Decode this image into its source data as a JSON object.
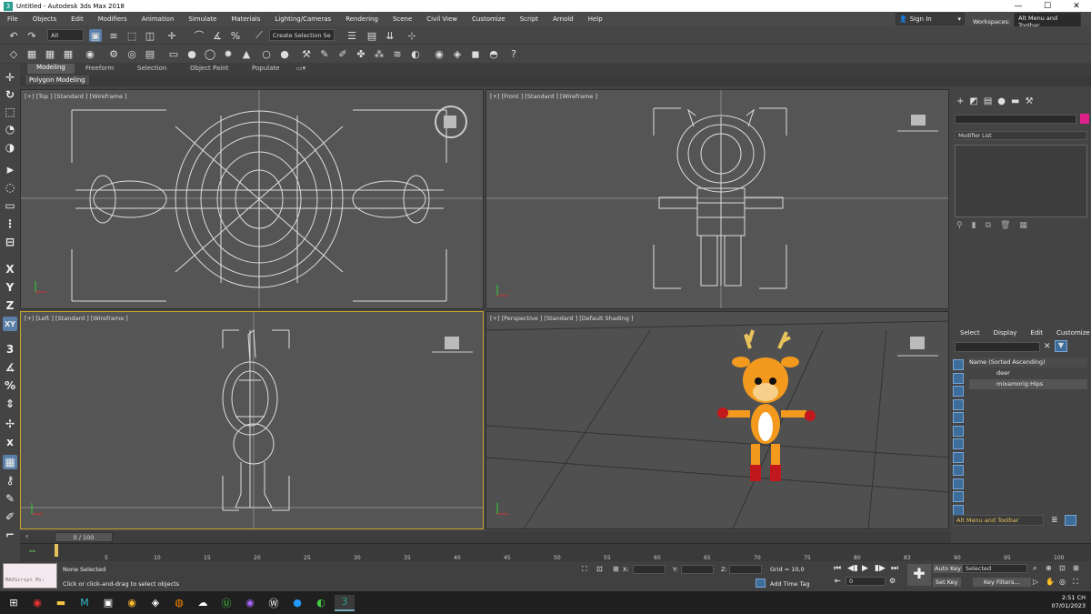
{
  "window": {
    "title": "Untitled - Autodesk 3ds Max 2018",
    "min": "—",
    "max": "☐",
    "close": "✕"
  },
  "menu": {
    "items": [
      "File",
      "Objects",
      "Edit",
      "Modifiers",
      "Animation",
      "Simulate",
      "Materials",
      "Lighting/Cameras",
      "Rendering",
      "Scene",
      "Civil View",
      "Customize",
      "Script",
      "Arnold",
      "Help"
    ],
    "sign_in": "Sign In",
    "workspaces_label": "Workspaces:",
    "workspaces_value": "Alt Menu and Toolbar"
  },
  "toolbar": {
    "filter_value": "All",
    "selection_set": "Create Selection Se"
  },
  "ribbon": {
    "tabs": [
      "Modeling",
      "Freeform",
      "Selection",
      "Object Paint",
      "Populate"
    ],
    "active_tab": "Modeling",
    "sub_label": "Polygon Modeling"
  },
  "viewports": {
    "top": "[+] [Top ] [Standard ] [Wireframe ]",
    "front": "[+] [Front ] [Standard ] [Wireframe ]",
    "left": "[+] [Left ] [Standard ] [Wireframe ]",
    "perspective": "[+] [Perspective ] [Standard ] [Default Shading ]"
  },
  "command_panel": {
    "modifier_list": "Modifier List",
    "scene_tabs": [
      "Select",
      "Display",
      "Edit",
      "Customize"
    ],
    "sort_header": "Name (Sorted Ascending)",
    "objects": [
      "deer",
      "mixamorig:Hips"
    ],
    "workspace_dropdown": "Alt Menu and Toolbar"
  },
  "timeline": {
    "frame_display": "0 / 100",
    "ticks": [
      "5",
      "10",
      "15",
      "20",
      "25",
      "30",
      "35",
      "40",
      "45",
      "50",
      "55",
      "60",
      "65",
      "70",
      "75",
      "80",
      "83",
      "90",
      "95",
      "100"
    ]
  },
  "status": {
    "maxscript": "MAXScript Mi:",
    "selection": "None Selected",
    "prompt": "Click or click-and-drag to select objects",
    "x_label": "X:",
    "y_label": "Y:",
    "z_label": "Z:",
    "grid": "Grid = 10,0",
    "add_time_tag": "Add Time Tag",
    "auto_key": "Auto Key",
    "set_key": "Set Key",
    "selected_value": "Selected",
    "key_filters": "Key Filters...",
    "frame_field": "0"
  },
  "taskbar": {
    "time": "2:51 CH",
    "date": "07/01/2023"
  },
  "colors": {
    "accent_active_tool": "#5a7fa8",
    "active_viewport_border": "#c8a52a",
    "deer_orange": "#f39a1e",
    "deer_red": "#c0181c",
    "object_color_swatch": "#e0208a"
  }
}
